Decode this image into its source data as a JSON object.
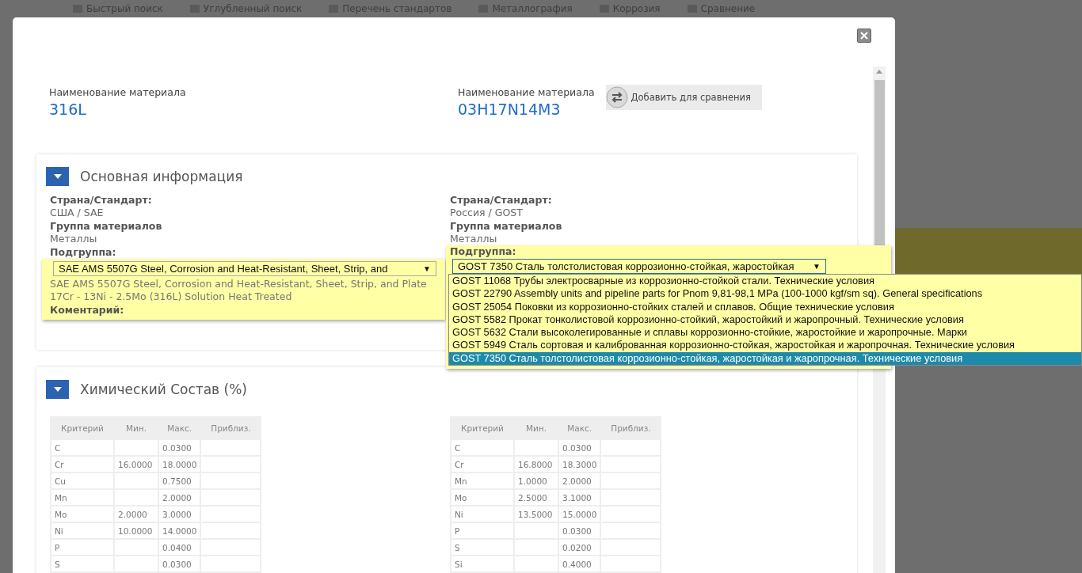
{
  "background_nav": [
    {
      "label": "Быстрый поиск"
    },
    {
      "label": "Углубленный поиск"
    },
    {
      "label": "Перечень стандартов"
    },
    {
      "label": "Металлография"
    },
    {
      "label": "Коррозия"
    },
    {
      "label": "Сравнение"
    }
  ],
  "materials": [
    {
      "label": "Наименование материала",
      "name": "316L"
    },
    {
      "label": "Наименование материала",
      "name": "03H17N14M3"
    }
  ],
  "compare_button": "Добавить для сравнения",
  "basic_info": {
    "title": "Основная информация",
    "expanded": true,
    "columns": [
      {
        "fields": [
          {
            "label": "Страна/Стандарт:",
            "value": "США / SAE"
          },
          {
            "label": "Группа материалов",
            "value": "Металлы"
          }
        ],
        "subgroup_label": "Подгруппа:",
        "subgroup_select": "SAE AMS 5507G Steel, Corrosion and Heat-Resistant, Sheet, Strip, and",
        "select_caret": "▼",
        "description": "SAE AMS 5507G Steel, Corrosion and Heat-Resistant, Sheet, Strip, and Plate 17Cr - 13Ni - 2.5Mo (316L) Solution Heat Treated",
        "comment_label": "Коментарий:"
      },
      {
        "fields": [
          {
            "label": "Страна/Стандарт:",
            "value": "Россия / GOST"
          },
          {
            "label": "Группа материалов",
            "value": "Металлы"
          }
        ],
        "subgroup_label": "Подгруппа:",
        "subgroup_select": "GOST 7350 Сталь толстолистовая коррозионно-стойкая, жаростойкая",
        "select_caret": "▼",
        "options": [
          {
            "label": "GOST 11068 Трубы электросварные из коррозионно-стойкой стали. Технические условия",
            "selected": false
          },
          {
            "label": "GOST 22790 Assembly units and pipeline parts for Pnom 9,81-98,1 MPa (100-1000 kgf/sm sq). General specifications",
            "selected": false
          },
          {
            "label": "GOST 25054 Поковки из коррозионно-стойких сталей и сплавов. Общие технические условия",
            "selected": false
          },
          {
            "label": "GOST 5582 Прокат тонколистовой коррозионно-стойкий, жаростойкий и жаропрочный. Технические условия",
            "selected": false
          },
          {
            "label": "GOST 5632 Стали высоколегированные и сплавы коррозионно-стойкие, жаростойкие и жаропрочные. Марки",
            "selected": false
          },
          {
            "label": "GOST 5949 Сталь сортовая и калиброванная коррозионно-стойкая, жаростойкая и жаропрочная. Технические условия",
            "selected": false
          },
          {
            "label": "GOST 7350 Сталь толстолистовая коррозионно-стойкая, жаростойкая и жаропрочная. Технические условия",
            "selected": true
          }
        ]
      }
    ]
  },
  "chemistry": {
    "title": "Химический Состав (%)",
    "expanded": true,
    "tables": [
      {
        "columns": [
          "Критерий",
          "Мин.",
          "Макс.",
          "Приблиз."
        ],
        "rows": [
          [
            "C",
            "",
            "0.0300",
            ""
          ],
          [
            "Cr",
            "16.0000",
            "18.0000",
            ""
          ],
          [
            "Cu",
            "",
            "0.7500",
            ""
          ],
          [
            "Mn",
            "",
            "2.0000",
            ""
          ],
          [
            "Mo",
            "2.0000",
            "3.0000",
            ""
          ],
          [
            "Ni",
            "10.0000",
            "14.0000",
            ""
          ],
          [
            "P",
            "",
            "0.0400",
            ""
          ],
          [
            "S",
            "",
            "0.0300",
            ""
          ]
        ]
      },
      {
        "columns": [
          "Критерий",
          "Мин.",
          "Макс.",
          "Приблиз."
        ],
        "rows": [
          [
            "C",
            "",
            "0.0300",
            ""
          ],
          [
            "Cr",
            "16.8000",
            "18.3000",
            ""
          ],
          [
            "Mn",
            "1.0000",
            "2.0000",
            ""
          ],
          [
            "Mo",
            "2.5000",
            "3.1000",
            ""
          ],
          [
            "Ni",
            "13.5000",
            "15.0000",
            ""
          ],
          [
            "P",
            "",
            "0.0300",
            ""
          ],
          [
            "S",
            "",
            "0.0200",
            ""
          ],
          [
            "Si",
            "",
            "0.4000",
            ""
          ]
        ]
      }
    ]
  }
}
